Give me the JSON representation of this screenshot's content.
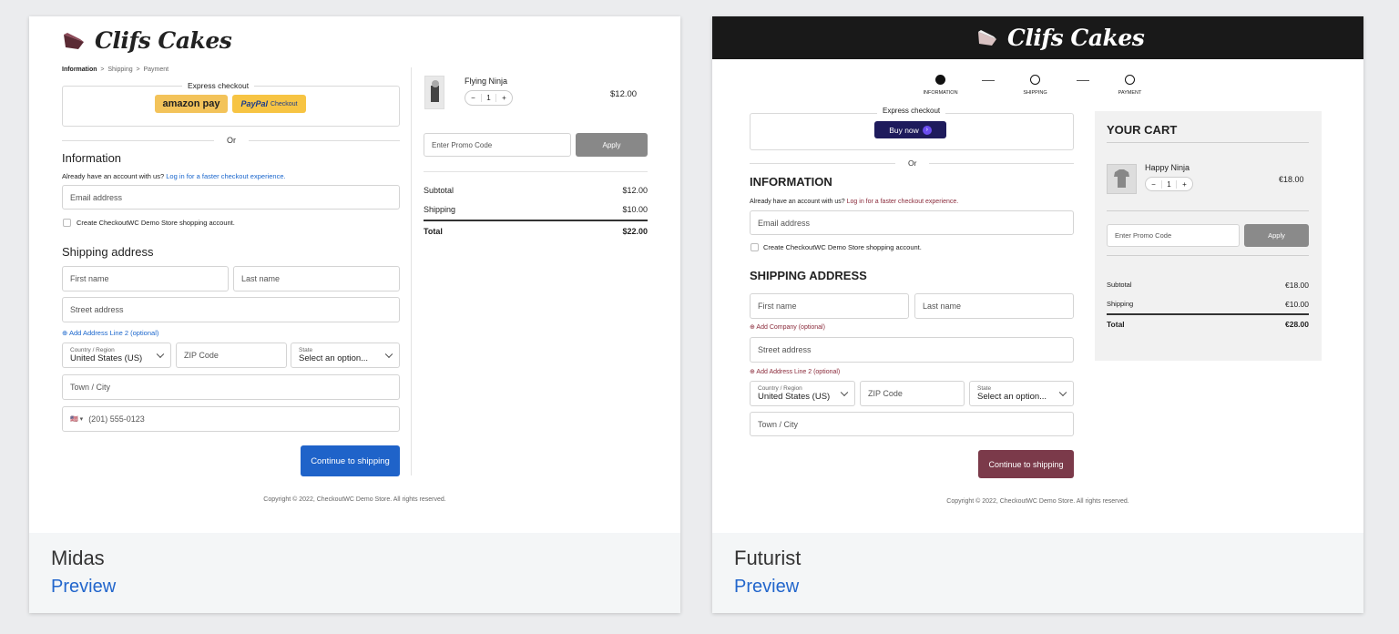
{
  "themes": [
    {
      "logo": "Clifs Cakes",
      "breadcrumb": {
        "step1": "Information",
        "sep": ">",
        "step2": "Shipping",
        "step3": "Payment"
      },
      "express_label": "Express checkout",
      "amazon_label": "amazon pay",
      "paypal_label": "PayPal",
      "paypal_sub": "Checkout",
      "or_label": "Or",
      "info_heading": "Information",
      "account_text": "Already have an account with us?",
      "login_link": "Log in for a faster checkout experience.",
      "email_placeholder": "Email address",
      "create_account": "Create CheckoutWC Demo Store shopping account.",
      "shipping_heading": "Shipping address",
      "first_name": "First name",
      "last_name": "Last name",
      "street": "Street address",
      "add_line2": "⊕ Add Address Line 2 (optional)",
      "country_label": "Country / Region",
      "country_value": "United States (US)",
      "zip": "ZIP Code",
      "state_label": "State",
      "state_value": "Select an option...",
      "town": "Town / City",
      "phone_flag": "🇺🇸 ▾",
      "phone": "(201) 555-0123",
      "continue": "Continue to shipping",
      "copyright": "Copyright © 2022, CheckoutWC Demo Store. All rights reserved.",
      "product": {
        "name": "Flying Ninja",
        "qty": "1",
        "minus": "−",
        "plus": "+",
        "price": "$12.00"
      },
      "promo_placeholder": "Enter Promo Code",
      "apply": "Apply",
      "subtotal_label": "Subtotal",
      "subtotal": "$12.00",
      "shipping_label": "Shipping",
      "shipping": "$10.00",
      "total_label": "Total",
      "total": "$22.00",
      "theme_name": "Midas",
      "preview": "Preview",
      "accent": "#1f63c9"
    },
    {
      "logo": "Clifs Cakes",
      "steps": [
        "INFORMATION",
        "SHIPPING",
        "PAYMENT"
      ],
      "express_label": "Express checkout",
      "buy_now": "Buy now",
      "or_label": "Or",
      "info_heading": "INFORMATION",
      "account_text": "Already have an account with us?",
      "login_link": "Log in for a faster checkout experience.",
      "email_placeholder": "Email address",
      "create_account": "Create CheckoutWC Demo Store shopping account.",
      "shipping_heading": "SHIPPING ADDRESS",
      "first_name": "First name",
      "last_name": "Last name",
      "add_company": "⊕ Add Company (optional)",
      "street": "Street address",
      "add_line2": "⊕ Add Address Line 2 (optional)",
      "country_label": "Country / Region",
      "country_value": "United States (US)",
      "zip": "ZIP Code",
      "state_label": "State",
      "state_value": "Select an option...",
      "town": "Town / City",
      "continue": "Continue to shipping",
      "copyright": "Copyright © 2022, CheckoutWC Demo Store. All rights reserved.",
      "cart_heading": "YOUR CART",
      "product": {
        "name": "Happy Ninja",
        "qty": "1",
        "minus": "−",
        "plus": "+",
        "price": "€18.00"
      },
      "promo_placeholder": "Enter Promo Code",
      "apply": "Apply",
      "subtotal_label": "Subtotal",
      "subtotal": "€18.00",
      "shipping_label": "Shipping",
      "shipping": "€10.00",
      "total_label": "Total",
      "total": "€28.00",
      "theme_name": "Futurist",
      "preview": "Preview",
      "accent": "#7b3a4a"
    }
  ]
}
